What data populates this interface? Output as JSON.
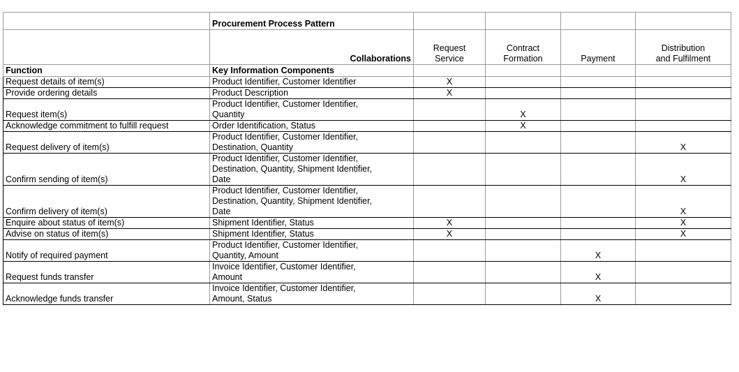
{
  "title": "Procurement Process Pattern",
  "collaborations_label": "Collaborations",
  "columns": [
    {
      "key": "request_service",
      "label_lines": [
        "Request",
        "Service"
      ]
    },
    {
      "key": "contract_formation",
      "label_lines": [
        "Contract",
        "Formation"
      ]
    },
    {
      "key": "payment",
      "label_lines": [
        "",
        "Payment"
      ]
    },
    {
      "key": "distribution",
      "label_lines": [
        "Distribution",
        "and Fulfilment"
      ]
    }
  ],
  "function_header": "Function",
  "components_header": "Key Information Components",
  "rows": [
    {
      "function": "Request details of item(s)",
      "components": [
        "Product Identifier, Customer Identifier"
      ],
      "marks": [
        "X",
        "",
        "",
        ""
      ]
    },
    {
      "function": "Provide ordering details",
      "components": [
        "Product Description"
      ],
      "marks": [
        "X",
        "",
        "",
        ""
      ]
    },
    {
      "function": "Request item(s)",
      "components": [
        "Product Identifier, Customer Identifier,",
        "Quantity"
      ],
      "marks": [
        "",
        "X",
        "",
        ""
      ]
    },
    {
      "function": "Acknowledge commitment to fulfill request",
      "components": [
        "Order Identification, Status"
      ],
      "marks": [
        "",
        "X",
        "",
        ""
      ]
    },
    {
      "function": "Request delivery of item(s)",
      "components": [
        "Product Identifier, Customer Identifier,",
        "Destination, Quantity"
      ],
      "marks": [
        "",
        "",
        "",
        "X"
      ]
    },
    {
      "function": "Confirm sending of item(s)",
      "components": [
        "Product Identifier, Customer Identifier,",
        "Destination, Quantity, Shipment Identifier,",
        "Date"
      ],
      "marks": [
        "",
        "",
        "",
        "X"
      ]
    },
    {
      "function": "Confirm delivery of item(s)",
      "components": [
        "Product Identifier, Customer Identifier,",
        "Destination, Quantity, Shipment Identifier,",
        "Date"
      ],
      "marks": [
        "",
        "",
        "",
        "X"
      ]
    },
    {
      "function": "Enquire about status of item(s)",
      "components": [
        "Shipment Identifier, Status"
      ],
      "marks": [
        "X",
        "",
        "",
        "X"
      ]
    },
    {
      "function": "Advise on status of item(s)",
      "components": [
        "Shipment Identifier, Status"
      ],
      "marks": [
        "X",
        "",
        "",
        "X"
      ]
    },
    {
      "function": "Notify of required payment",
      "components": [
        "Product Identifier, Customer Identifier,",
        "Quantity, Amount"
      ],
      "marks": [
        "",
        "",
        "X",
        ""
      ]
    },
    {
      "function": "Request funds transfer",
      "components": [
        "Invoice Identifier, Customer Identifier,",
        "Amount"
      ],
      "marks": [
        "",
        "",
        "X",
        ""
      ]
    },
    {
      "function": "Acknowledge funds transfer",
      "components": [
        "Invoice Identifier, Customer Identifier,",
        "Amount, Status"
      ],
      "marks": [
        "",
        "",
        "X",
        ""
      ]
    }
  ]
}
